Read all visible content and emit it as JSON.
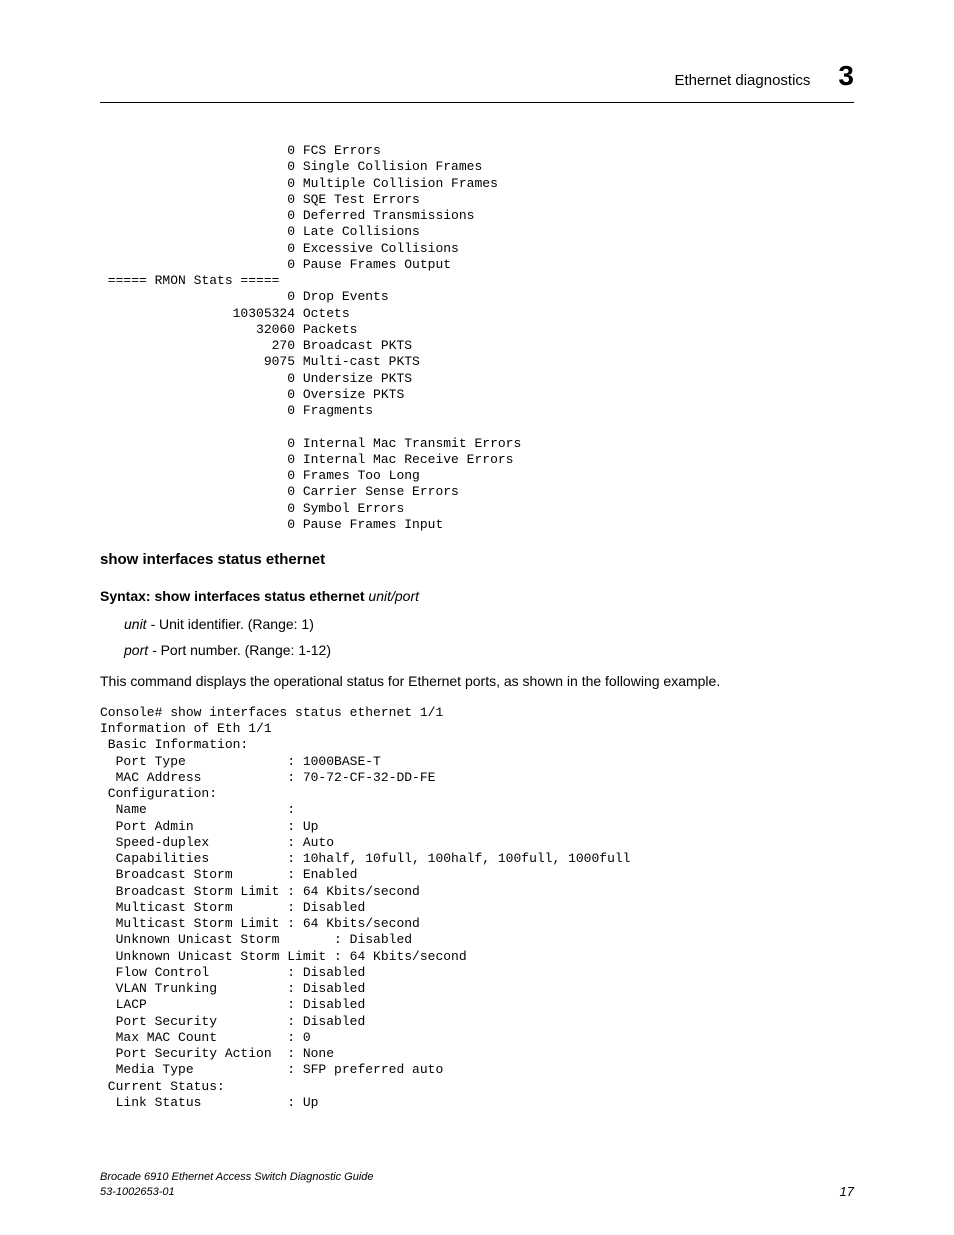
{
  "header": {
    "section": "Ethernet diagnostics",
    "chapter": "3"
  },
  "code_block_1": "                        0 FCS Errors\n                        0 Single Collision Frames\n                        0 Multiple Collision Frames\n                        0 SQE Test Errors\n                        0 Deferred Transmissions\n                        0 Late Collisions\n                        0 Excessive Collisions\n                        0 Pause Frames Output\n ===== RMON Stats =====\n                        0 Drop Events\n                 10305324 Octets\n                    32060 Packets\n                      270 Broadcast PKTS\n                     9075 Multi-cast PKTS\n                        0 Undersize PKTS\n                        0 Oversize PKTS\n                        0 Fragments\n\n                        0 Internal Mac Transmit Errors\n                        0 Internal Mac Receive Errors\n                        0 Frames Too Long\n                        0 Carrier Sense Errors\n                        0 Symbol Errors\n                        0 Pause Frames Input",
  "subhead": "show interfaces status ethernet",
  "syntax": {
    "label": "Syntax:",
    "cmd": "show interfaces status ethernet",
    "arg": "unit/port"
  },
  "params": {
    "unit": {
      "name": "unit -",
      "desc": "Unit identifier. (Range: 1)"
    },
    "port": {
      "name": "port -",
      "desc": "Port number. (Range: 1-12)"
    }
  },
  "bodytext": "This command displays the operational status for Ethernet ports, as shown in the following example.",
  "code_block_2": "Console# show interfaces status ethernet 1/1\nInformation of Eth 1/1\n Basic Information:\n  Port Type             : 1000BASE-T\n  MAC Address           : 70-72-CF-32-DD-FE\n Configuration:\n  Name                  :\n  Port Admin            : Up\n  Speed-duplex          : Auto\n  Capabilities          : 10half, 10full, 100half, 100full, 1000full\n  Broadcast Storm       : Enabled\n  Broadcast Storm Limit : 64 Kbits/second\n  Multicast Storm       : Disabled\n  Multicast Storm Limit : 64 Kbits/second\n  Unknown Unicast Storm       : Disabled\n  Unknown Unicast Storm Limit : 64 Kbits/second\n  Flow Control          : Disabled\n  VLAN Trunking         : Disabled\n  LACP                  : Disabled\n  Port Security         : Disabled\n  Max MAC Count         : 0\n  Port Security Action  : None\n  Media Type            : SFP preferred auto\n Current Status:\n  Link Status           : Up",
  "footer": {
    "title": "Brocade 6910 Ethernet Access Switch Diagnostic Guide",
    "docnum": "53-1002653-01",
    "page": "17"
  }
}
